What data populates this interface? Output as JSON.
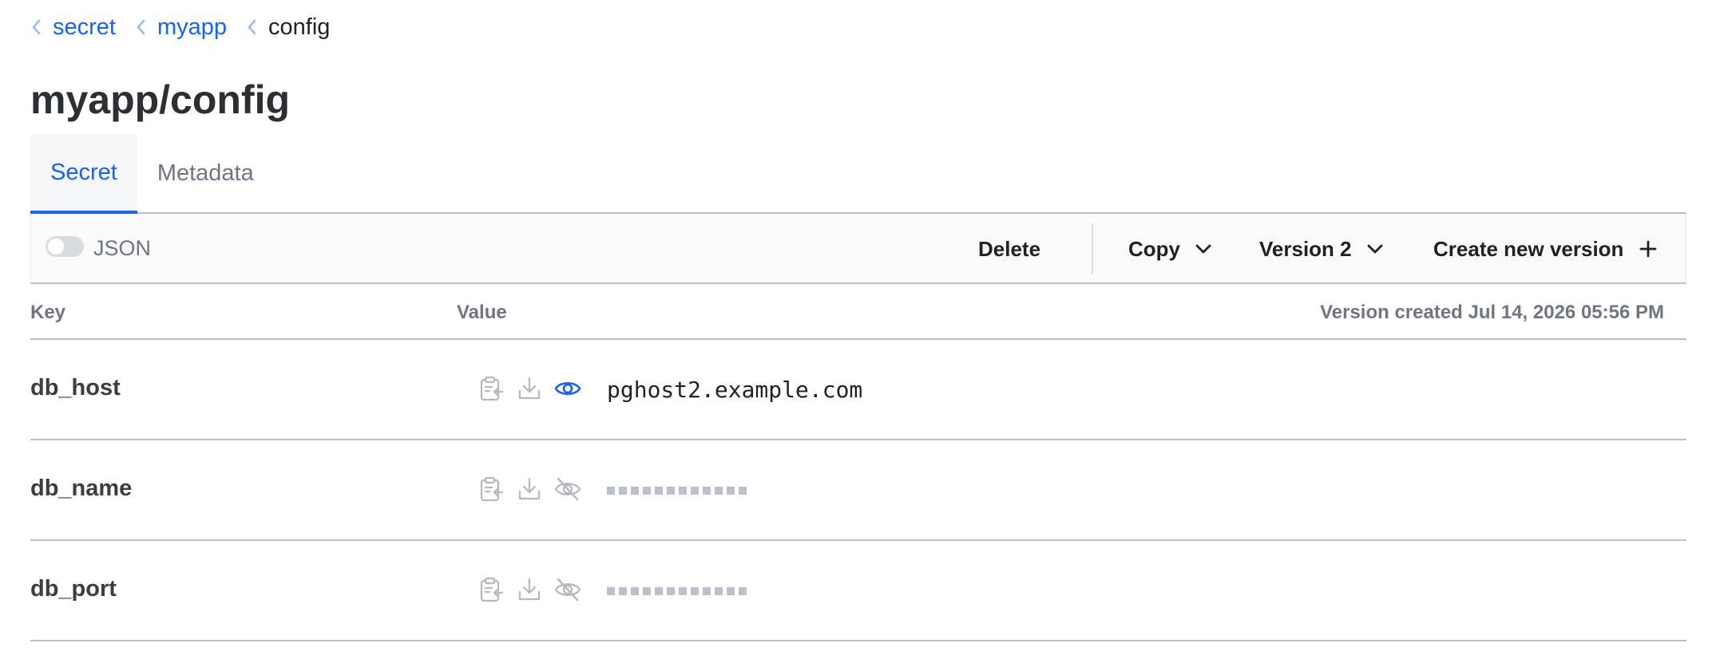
{
  "breadcrumbs": [
    {
      "label": "secret"
    },
    {
      "label": "myapp"
    },
    {
      "label": "config"
    }
  ],
  "page_title": "myapp/config",
  "tabs": [
    {
      "label": "Secret",
      "active": true
    },
    {
      "label": "Metadata",
      "active": false
    }
  ],
  "toolbar": {
    "json_toggle_label": "JSON",
    "json_toggle_on": false,
    "delete_label": "Delete",
    "copy_label": "Copy",
    "version_label": "Version 2",
    "create_label": "Create new version"
  },
  "table": {
    "key_header": "Key",
    "value_header": "Value",
    "version_created": "Version created Jul 14, 2026 05:56 PM",
    "rows": [
      {
        "key": "db_host",
        "value": "pghost2.example.com",
        "visible": true
      },
      {
        "key": "db_name",
        "value": "",
        "visible": false
      },
      {
        "key": "db_port",
        "value": "",
        "visible": false
      }
    ]
  },
  "icons": {
    "breadcrumb_chevron": "chevron-left-icon",
    "copy_value": "clipboard-copy-icon",
    "download": "download-icon",
    "reveal": "eye-icon",
    "hidden": "eye-off-icon",
    "dropdown": "chevron-down-icon",
    "add": "plus-icon"
  },
  "colors": {
    "link": "#1563ff",
    "active_tab": "#1563ff",
    "border": "#bac1cc",
    "muted": "#6f7682",
    "icon_gray": "#b4b8bf",
    "eye_active": "#1563ff"
  }
}
